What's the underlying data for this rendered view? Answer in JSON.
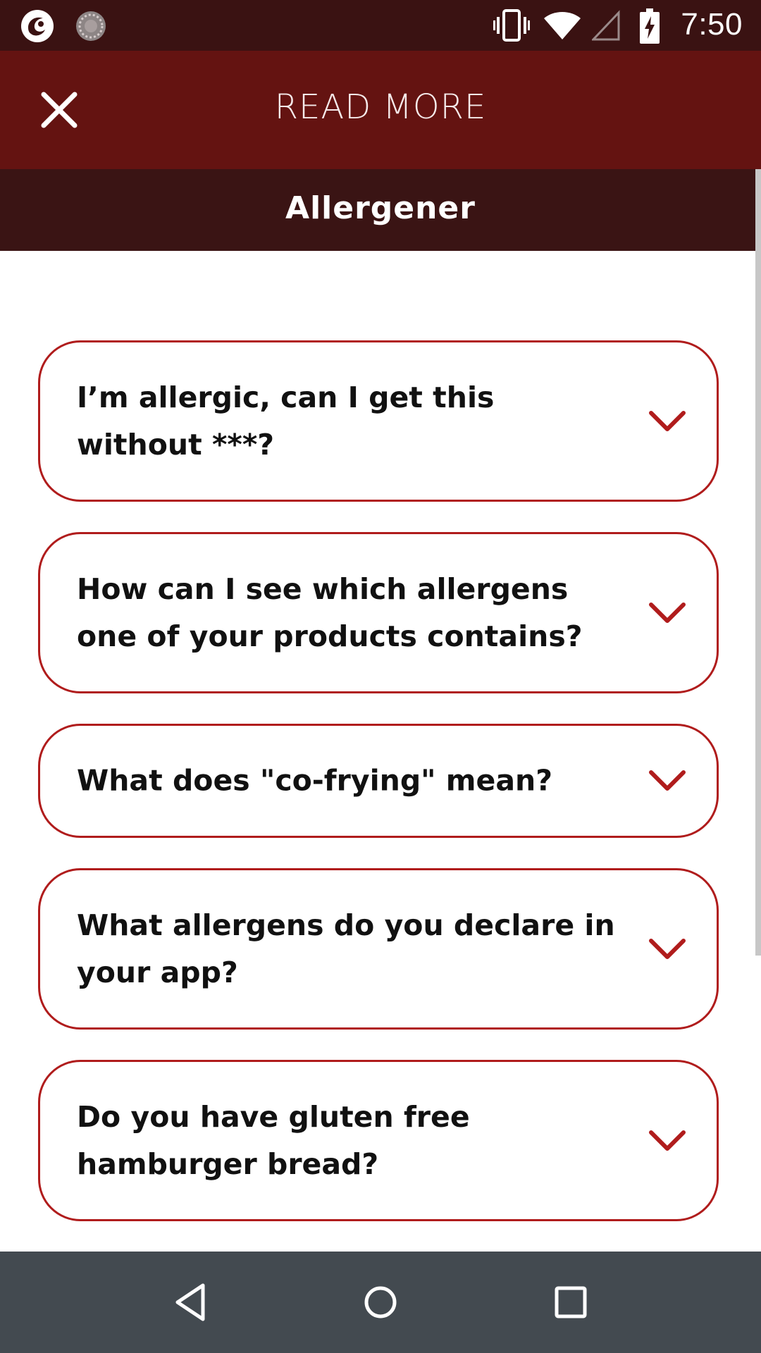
{
  "status_bar": {
    "time": "7:50",
    "icons": [
      "app-logo-icon",
      "loading-spinner-icon",
      "vibrate-icon",
      "wifi-icon",
      "signal-icon",
      "battery-charging-icon"
    ]
  },
  "header": {
    "title": "READ MORE",
    "close_icon": "close-icon"
  },
  "section": {
    "title": "Allergener"
  },
  "faq": {
    "items": [
      {
        "question": "I’m allergic, can I get this without ***?"
      },
      {
        "question": "How can I see which allergens one of your products contains?"
      },
      {
        "question": "What does \"co-frying\" mean?"
      },
      {
        "question": "What allergens do you declare in your app?"
      },
      {
        "question": "Do you have gluten free hamburger bread?"
      }
    ]
  },
  "nav_bar": {
    "icons": [
      "back-icon",
      "home-icon",
      "recents-icon"
    ]
  },
  "colors": {
    "status_bar": "#3a1212",
    "header": "#641311",
    "section_banner": "#3a1414",
    "accent": "#b01c1c",
    "nav_bar": "#434a50"
  }
}
